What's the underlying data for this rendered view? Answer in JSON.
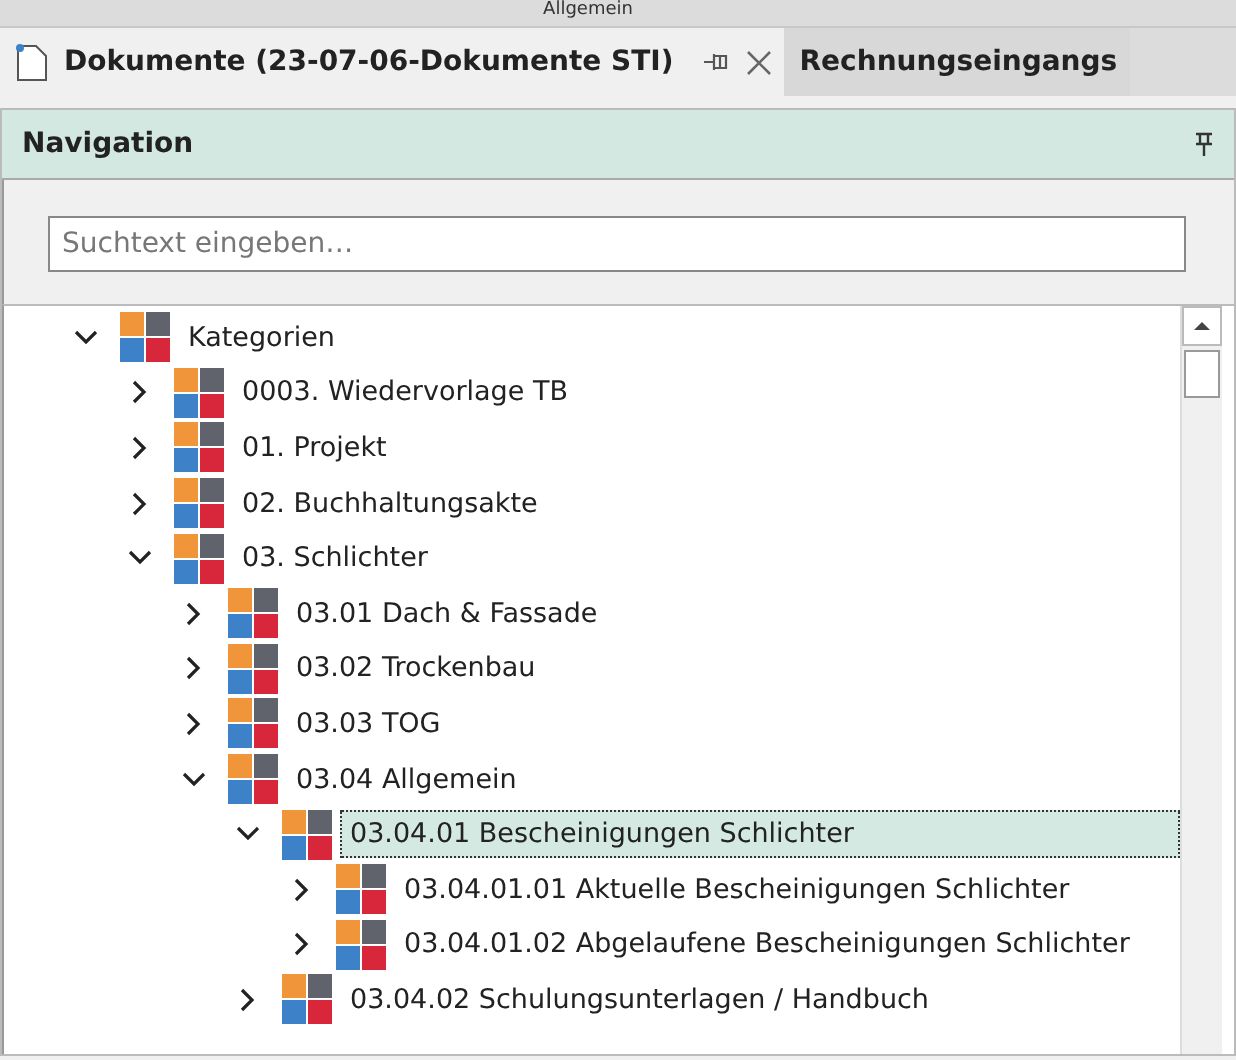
{
  "ribbon": {
    "group_label": "Allgemein"
  },
  "tabs": [
    {
      "label": "Dokumente (23-07-06-Dokumente STI)",
      "selected": true,
      "closable": true
    },
    {
      "label": "Rechnungseingangs",
      "selected": false,
      "closable": false
    }
  ],
  "navigation": {
    "title": "Navigation",
    "search": {
      "placeholder": "Suchtext eingeben…"
    }
  },
  "tree": [
    {
      "label": "Kategorien",
      "expanded": true,
      "selected": false,
      "children": [
        {
          "label": "0003. Wiedervorlage TB",
          "expanded": false,
          "selected": false
        },
        {
          "label": "01. Projekt",
          "expanded": false,
          "selected": false
        },
        {
          "label": "02. Buchhaltungsakte",
          "expanded": false,
          "selected": false
        },
        {
          "label": "03. Schlichter",
          "expanded": true,
          "selected": false,
          "children": [
            {
              "label": "03.01 Dach & Fassade",
              "expanded": false,
              "selected": false
            },
            {
              "label": "03.02 Trockenbau",
              "expanded": false,
              "selected": false
            },
            {
              "label": "03.03 TOG",
              "expanded": false,
              "selected": false
            },
            {
              "label": "03.04 Allgemein",
              "expanded": true,
              "selected": false,
              "children": [
                {
                  "label": "03.04.01 Bescheinigungen Schlichter",
                  "expanded": true,
                  "selected": true,
                  "children": [
                    {
                      "label": "03.04.01.01 Aktuelle Bescheinigungen Schlichter",
                      "expanded": false,
                      "selected": false
                    },
                    {
                      "label": "03.04.01.02 Abgelaufene Bescheinigungen Schlichter",
                      "expanded": false,
                      "selected": false
                    }
                  ]
                },
                {
                  "label": "03.04.02 Schulungsunterlagen / Handbuch",
                  "expanded": false,
                  "selected": false
                }
              ]
            }
          ]
        }
      ]
    }
  ]
}
